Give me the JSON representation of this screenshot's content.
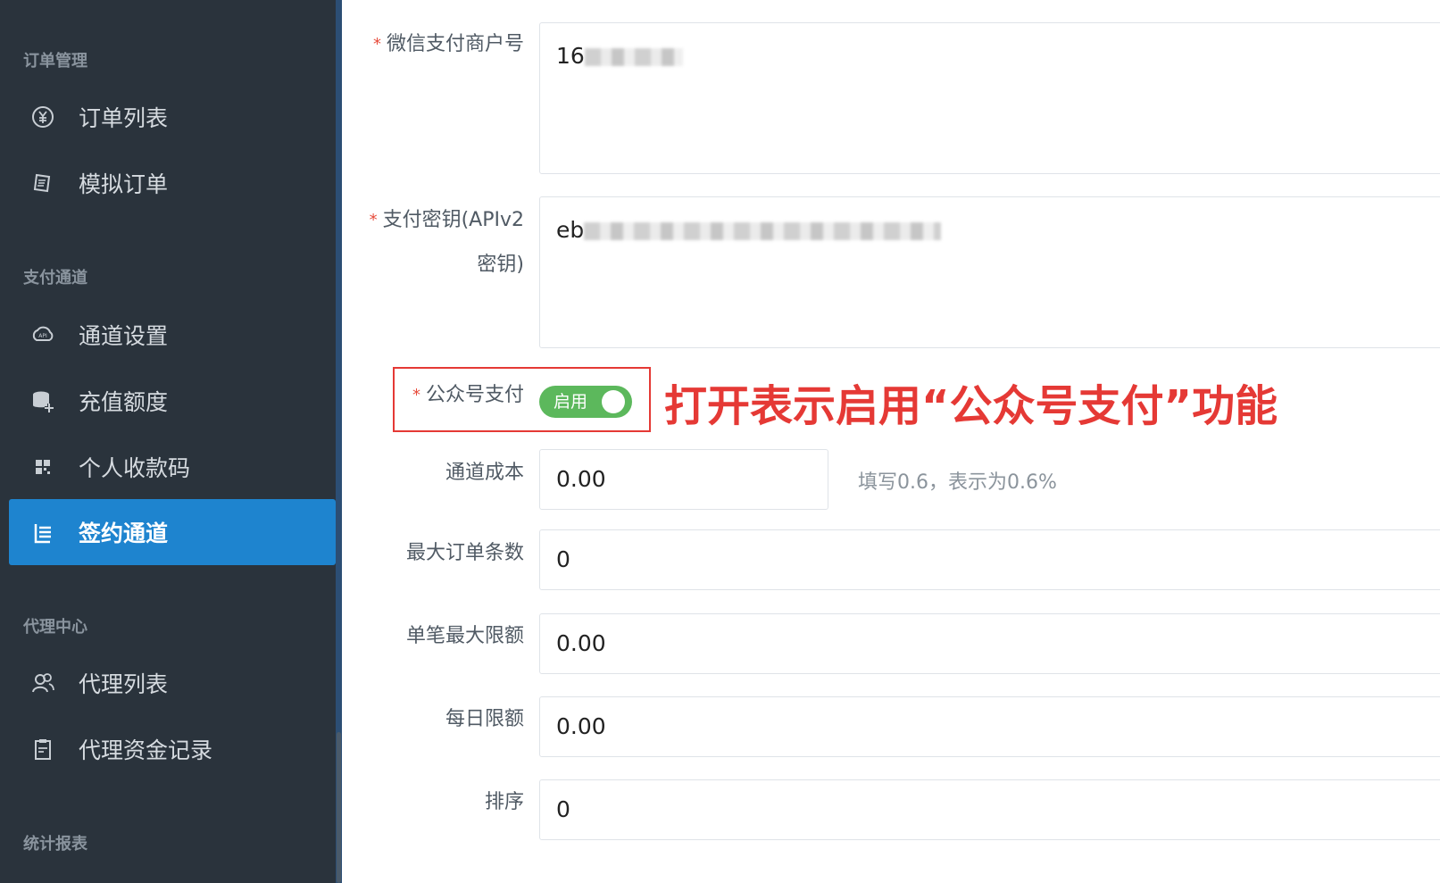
{
  "sidebar": {
    "sections": {
      "orders": "订单管理",
      "channels": "支付通道",
      "agents": "代理中心",
      "reports": "统计报表"
    },
    "items": {
      "order_list": "订单列表",
      "mock_order": "模拟订单",
      "channel_settings": "通道设置",
      "recharge_quota": "充值额度",
      "personal_qr": "个人收款码",
      "signed_channel": "签约通道",
      "agent_list": "代理列表",
      "agent_funds": "代理资金记录"
    }
  },
  "form": {
    "merchant_id": {
      "label": "微信支付商户号",
      "value_prefix": "16"
    },
    "api_key": {
      "label_line1": "支付密钥(APIv2",
      "label_line2": "密钥)",
      "value_prefix": "eb"
    },
    "official_account_pay": {
      "label": "公众号支付",
      "toggle_text": "启用",
      "enabled": true
    },
    "channel_cost": {
      "label": "通道成本",
      "value": "0.00",
      "hint": "填写0.6，表示为0.6%"
    },
    "max_orders": {
      "label": "最大订单条数",
      "value": "0"
    },
    "single_max": {
      "label": "单笔最大限额",
      "value": "0.00"
    },
    "daily_limit": {
      "label": "每日限额",
      "value": "0.00"
    },
    "sort": {
      "label": "排序",
      "value": "0"
    },
    "required_mark": "*"
  },
  "annotation": "打开表示启用“公众号支付”功能",
  "colors": {
    "sidebar_bg": "#2a333c",
    "active_item": "#1e84cf",
    "toggle_on": "#5cb85c",
    "annotation": "#e53935"
  }
}
